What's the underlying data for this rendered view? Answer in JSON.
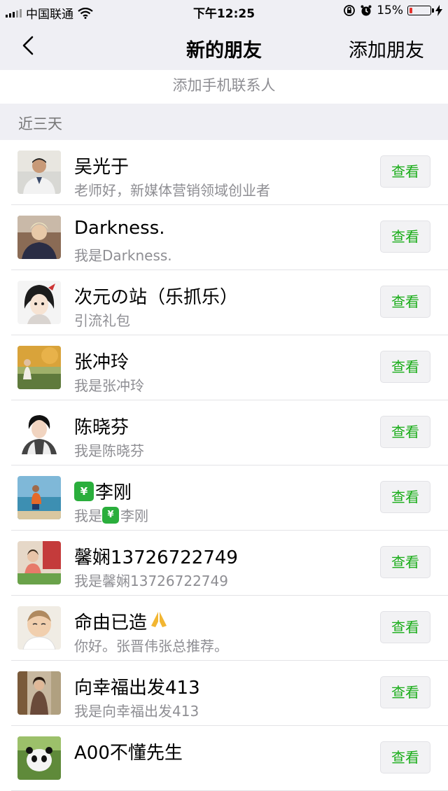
{
  "status_bar": {
    "carrier": "中国联通",
    "time": "下午12:25",
    "battery": "15%",
    "battery_level": 0.15,
    "battery_color": "#e5322d"
  },
  "nav": {
    "title": "新的朋友",
    "action": "添加朋友"
  },
  "add_phone_contacts": "添加手机联系人",
  "section_header": "近三天",
  "accent_color": "#1aad19",
  "requests": [
    {
      "name": "吴光于",
      "message": "老师好，新媒体营销领域创业者",
      "button": "查看"
    },
    {
      "name": "Darkness.",
      "message": "我是Darkness.",
      "button": "查看"
    },
    {
      "name": "次元の站（乐抓乐）",
      "message": "引流礼包",
      "button": "查看"
    },
    {
      "name": "张冲玲",
      "message": "我是张冲玲",
      "button": "查看"
    },
    {
      "name": "陈晓芬",
      "message": "我是陈晓芬",
      "button": "查看"
    },
    {
      "name": "李刚",
      "message_prefix": "我是",
      "message": "李刚",
      "button": "查看"
    },
    {
      "name": "馨娴13726722749",
      "message": "我是馨娴13726722749",
      "button": "查看"
    },
    {
      "name": "命由已造",
      "message": "你好。张晋伟张总推荐。",
      "button": "查看"
    },
    {
      "name": "向幸福出发413",
      "message": "我是向幸福出发413",
      "button": "查看"
    },
    {
      "name": "A00不懂先生",
      "message": "",
      "button": "查看"
    }
  ]
}
